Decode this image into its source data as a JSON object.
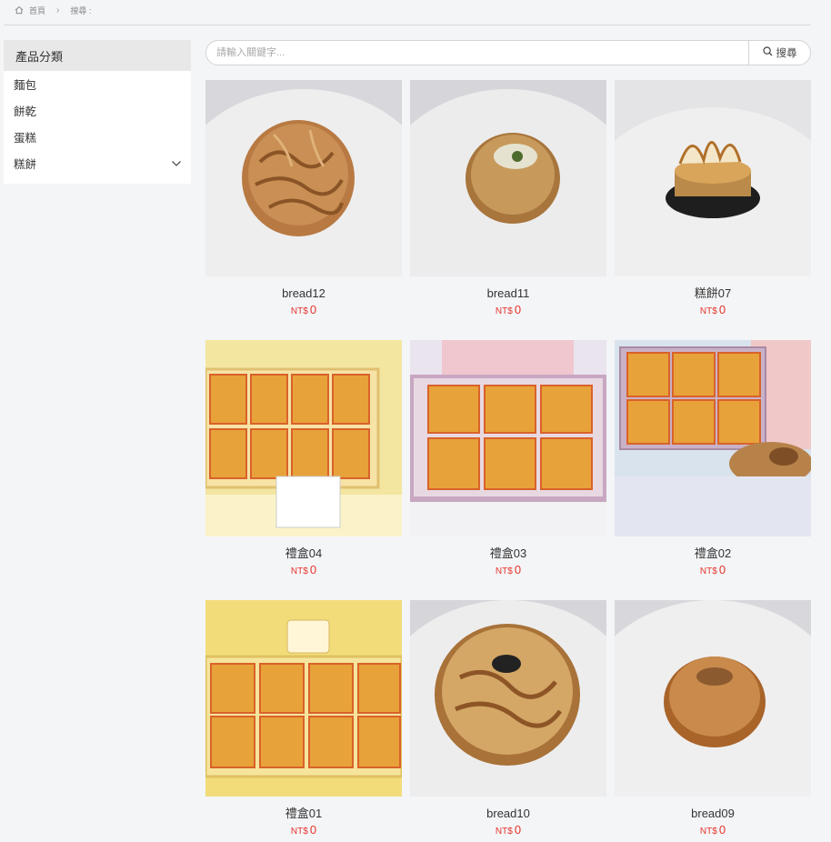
{
  "breadcrumb": {
    "home": "首頁",
    "current": "搜尋 :"
  },
  "sidebar": {
    "title": "產品分類",
    "items": [
      {
        "label": "麵包"
      },
      {
        "label": "餅乾"
      },
      {
        "label": "蛋糕"
      },
      {
        "label": "糕餅"
      }
    ]
  },
  "search": {
    "placeholder": "請輸入關鍵字...",
    "button_label": "搜尋"
  },
  "currency": "NT$",
  "products": [
    {
      "name": "bread12",
      "price": "0",
      "image": "melon-pan-bread"
    },
    {
      "name": "bread11",
      "price": "0",
      "image": "filled-bun-bread"
    },
    {
      "name": "糕餅07",
      "price": "0",
      "image": "lemon-meringue-tart"
    },
    {
      "name": "禮盒04",
      "price": "0",
      "image": "gift-box-eight-pastries"
    },
    {
      "name": "禮盒03",
      "price": "0",
      "image": "gift-box-six-pastries-pink"
    },
    {
      "name": "禮盒02",
      "price": "0",
      "image": "gift-box-six-pastries-snowflake"
    },
    {
      "name": "禮盒01",
      "price": "0",
      "image": "gift-box-eight-pastries-yellow"
    },
    {
      "name": "bread10",
      "price": "0",
      "image": "melon-pan-sesame"
    },
    {
      "name": "bread09",
      "price": "0",
      "image": "bagel"
    }
  ],
  "colors": {
    "price": "#e6332a",
    "sidebar_header_bg": "#e8e8e8",
    "page_bg": "#f4f5f7"
  }
}
